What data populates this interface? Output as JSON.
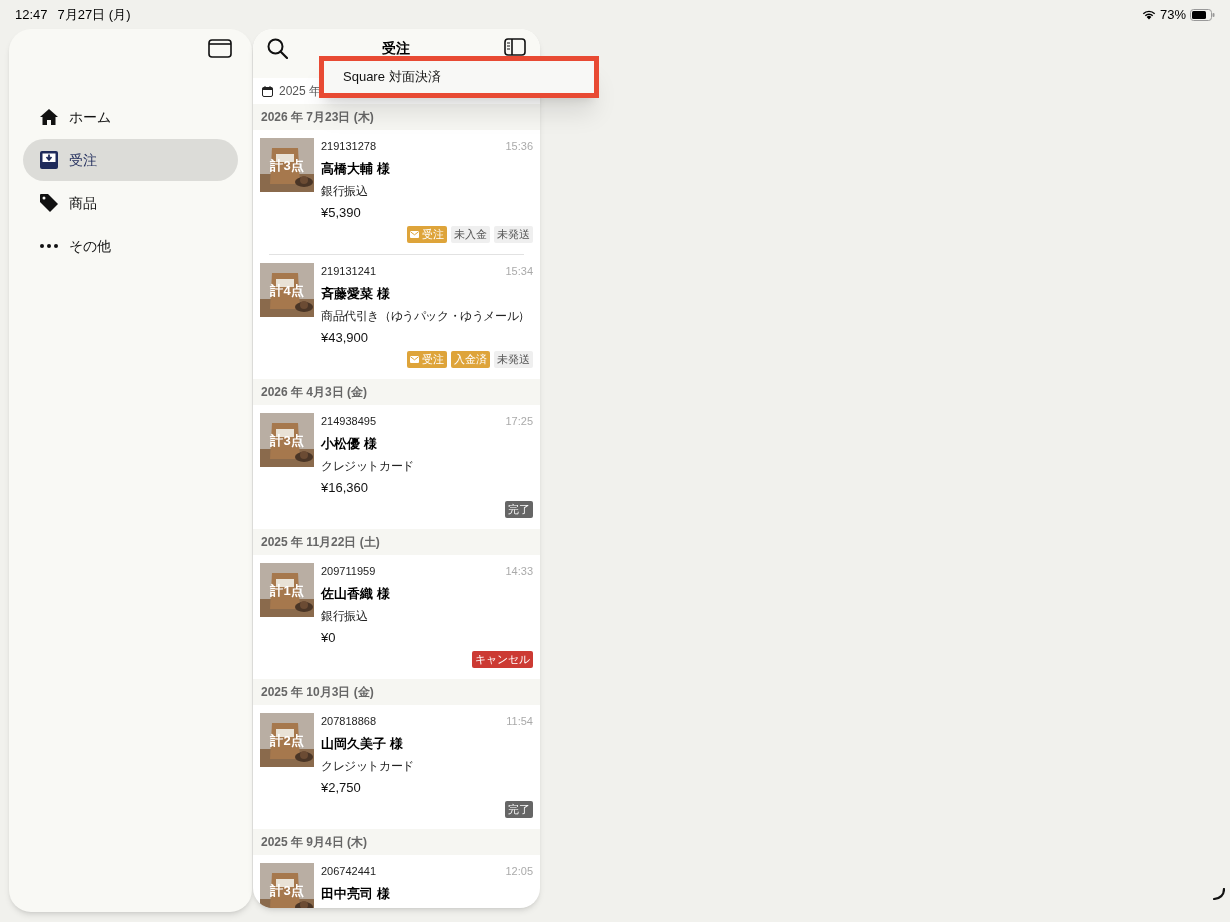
{
  "status_bar": {
    "time": "12:47",
    "date": "7月27日 (月)",
    "battery": "73%"
  },
  "sidebar": {
    "items": [
      {
        "label": "ホーム",
        "kind": "home",
        "selected": false
      },
      {
        "label": "受注",
        "kind": "inbox",
        "selected": true
      },
      {
        "label": "商品",
        "kind": "tag",
        "selected": false
      },
      {
        "label": "その他",
        "kind": "more",
        "selected": false
      }
    ]
  },
  "list_header": {
    "title": "受注"
  },
  "date_filter": {
    "label": "2025 年"
  },
  "popup_menu": {
    "items": [
      "Square 対面決済"
    ]
  },
  "groups": [
    {
      "date": "2026 年 7月23日 (木)",
      "orders": [
        {
          "count": "計3点",
          "id": "219131278",
          "time": "15:36",
          "name": "高橋大輔 様",
          "payment": "銀行振込",
          "amount": "¥5,390",
          "tags": [
            {
              "label": "受注",
              "kind": "order"
            },
            {
              "label": "未入金",
              "kind": "pending"
            },
            {
              "label": "未発送",
              "kind": "pending"
            }
          ]
        },
        {
          "count": "計4点",
          "id": "219131241",
          "time": "15:34",
          "name": "斉藤愛菜 様",
          "payment": "商品代引き（ゆうパック・ゆうメール）",
          "amount": "¥43,900",
          "tags": [
            {
              "label": "受注",
              "kind": "order"
            },
            {
              "label": "入金済",
              "kind": "paid"
            },
            {
              "label": "未発送",
              "kind": "pending"
            }
          ]
        }
      ]
    },
    {
      "date": "2026 年 4月3日 (金)",
      "orders": [
        {
          "count": "計3点",
          "id": "214938495",
          "time": "17:25",
          "name": "小松優 様",
          "payment": "クレジットカード",
          "amount": "¥16,360",
          "tags": [
            {
              "label": "完了",
              "kind": "done"
            }
          ]
        }
      ]
    },
    {
      "date": "2025 年 11月22日 (土)",
      "orders": [
        {
          "count": "計1点",
          "id": "209711959",
          "time": "14:33",
          "name": "佐山香織 様",
          "payment": "銀行振込",
          "amount": "¥0",
          "tags": [
            {
              "label": "キャンセル",
              "kind": "cancel"
            }
          ]
        }
      ]
    },
    {
      "date": "2025 年 10月3日 (金)",
      "orders": [
        {
          "count": "計2点",
          "id": "207818868",
          "time": "11:54",
          "name": "山岡久美子 様",
          "payment": "クレジットカード",
          "amount": "¥2,750",
          "tags": [
            {
              "label": "完了",
              "kind": "done"
            }
          ]
        }
      ]
    },
    {
      "date": "2025 年 9月4日 (木)",
      "orders": [
        {
          "count": "計3点",
          "id": "206742441",
          "time": "12:05",
          "name": "田中亮司 様"
        }
      ]
    }
  ]
}
